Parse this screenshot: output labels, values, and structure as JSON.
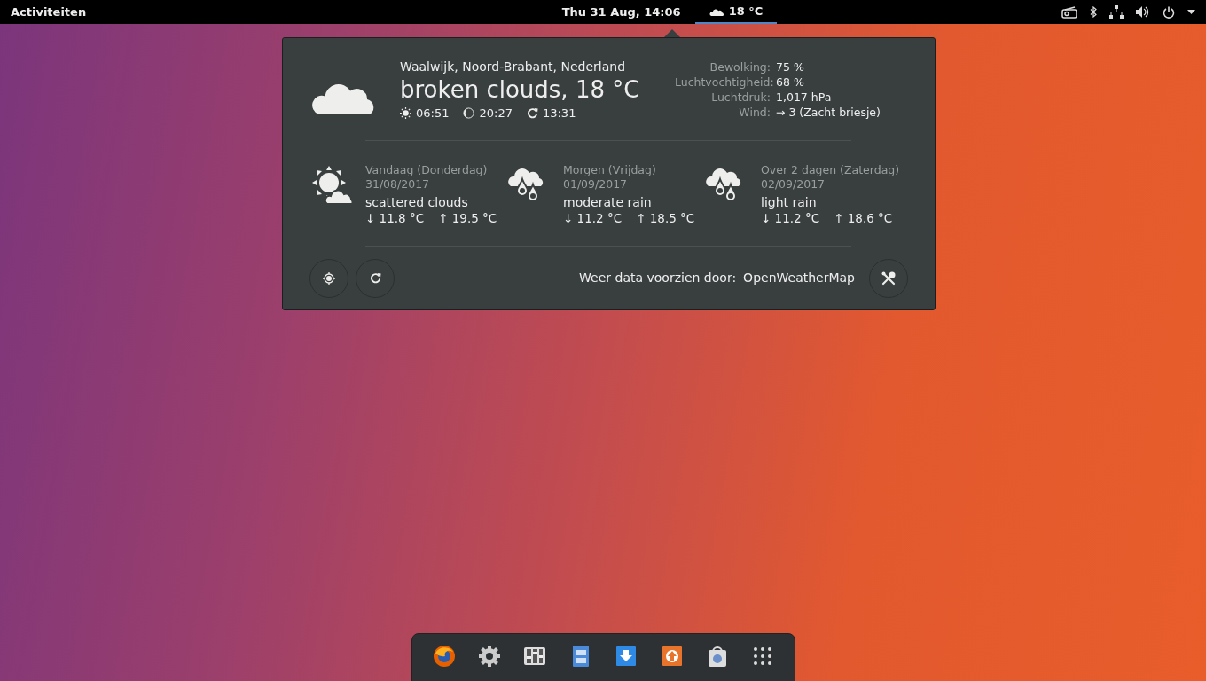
{
  "top_bar": {
    "activities": "Activiteiten",
    "clock": "Thu 31 Aug, 14:06",
    "weather_indicator": {
      "text": "18 °C",
      "selected": true
    },
    "status_icons": [
      {
        "kind": "radio"
      },
      {
        "kind": "bluetooth"
      },
      {
        "kind": "network"
      },
      {
        "kind": "volume"
      },
      {
        "kind": "power"
      }
    ]
  },
  "weather_popup": {
    "location": "Waalwijk, Noord-Brabant, Nederland",
    "summary": "broken clouds, 18 °C",
    "times": [
      {
        "kind": "sunrise",
        "text": "06:51"
      },
      {
        "kind": "sunset",
        "text": "20:27"
      },
      {
        "kind": "updated",
        "text": "13:31"
      }
    ],
    "details": [
      {
        "label": "Bewolking:",
        "value": "75 %"
      },
      {
        "label": "Luchtvochtigheid:",
        "value": "68 %"
      },
      {
        "label": "Luchtdruk:",
        "value": "1,017 hPa"
      },
      {
        "label": "Wind:",
        "value": "→ 3 (Zacht briesje)"
      }
    ],
    "forecast": [
      {
        "kind": "sun-cloud",
        "day": "Vandaag (Donderdag)",
        "date": "31/08/2017",
        "condition": "scattered clouds",
        "low": "↓ 11.8 °C",
        "high": "↑ 19.5 °C"
      },
      {
        "kind": "rain",
        "day": "Morgen (Vrijdag)",
        "date": "01/09/2017",
        "condition": "moderate rain",
        "low": "↓ 11.2 °C",
        "high": "↑ 18.5 °C"
      },
      {
        "kind": "rain",
        "day": "Over 2 dagen (Zaterdag)",
        "date": "02/09/2017",
        "condition": "light rain",
        "low": "↓ 11.2 °C",
        "high": "↑ 18.6 °C"
      }
    ],
    "provider_label": "Weer data voorzien door:",
    "provider": "OpenWeatherMap"
  },
  "dock": {
    "apps": [
      {
        "kind": "browser"
      },
      {
        "kind": "settings"
      },
      {
        "kind": "mixer"
      },
      {
        "kind": "files"
      },
      {
        "kind": "download"
      },
      {
        "kind": "update"
      },
      {
        "kind": "store"
      },
      {
        "kind": "grid"
      }
    ]
  }
}
